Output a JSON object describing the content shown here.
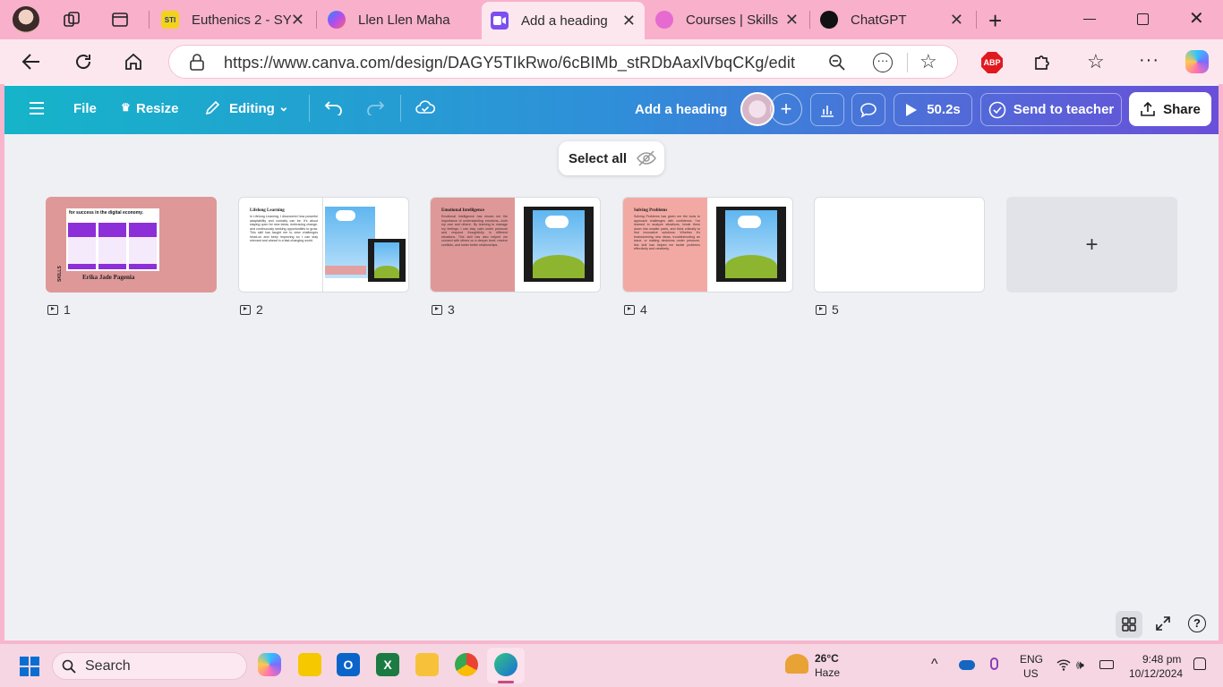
{
  "browser": {
    "tabs": [
      {
        "title": "Euthenics 2 - SY",
        "favicon_color": "#f3d21b",
        "favicon_text": "STI"
      },
      {
        "title": "Llen Llen Maha",
        "favicon_color": "#a36bf0"
      },
      {
        "title": "Add a heading",
        "favicon_color": "#7b4ff0",
        "active": true
      },
      {
        "title": "Courses | Skills",
        "favicon_color": "#e56bd0"
      },
      {
        "title": "ChatGPT",
        "favicon_color": "#111111"
      }
    ],
    "url": "https://www.canva.com/design/DAGY5TIkRwo/6cBIMb_stRDbAaxlVbqCKg/edit",
    "abp_label": "ABP"
  },
  "canva": {
    "menu": {
      "file": "File",
      "resize": "Resize",
      "editing": "Editing"
    },
    "title": "Add a heading",
    "timer": "50.2s",
    "send_to_teacher": "Send to teacher",
    "share": "Share",
    "select_all": "Select all",
    "slides": [
      {
        "number": "1",
        "heading": "for success in the digital economy.",
        "author": "Erika Jade Pagenia"
      },
      {
        "number": "2",
        "heading": "Lifelong Learning",
        "body": "In Lifelong Learning, I discovered how powerful adaptability and curiosity can be. It's about staying open for new ideas, embracing change, and continuously seeking opportunities to grow. This skill has taught me to view challenges head-on and keep improving so I can stay relevant and ahead in a fast-changing world."
      },
      {
        "number": "3",
        "heading": "Emotional Intelligence",
        "body": "Emotional Intelligence has shown me the importance of understanding emotions—both my own and others'. By learning to manage my feelings, I can stay calm under pressure and respond thoughtfully in different situations. This skill has also helped me connect with others on a deeper level, resolve conflicts, and foster better relationships."
      },
      {
        "number": "4",
        "heading": "Solving Problems",
        "body": "Solving Problems has given me the tools to approach challenges with confidence. I've learned to analyze situations, break them down into smaller parts, and think critically to find innovative solutions. Whether it's brainstorming new ideas, troubleshooting an issue, or making decisions under pressure, this skill has helped me tackle problems effectively and creatively."
      },
      {
        "number": "5"
      }
    ],
    "add_slide": "+"
  },
  "taskbar": {
    "search": "Search",
    "weather": {
      "temp": "26°C",
      "desc": "Haze"
    },
    "lang": {
      "line1": "ENG",
      "line2": "US"
    },
    "time": "9:48 pm",
    "date": "10/12/2024"
  }
}
